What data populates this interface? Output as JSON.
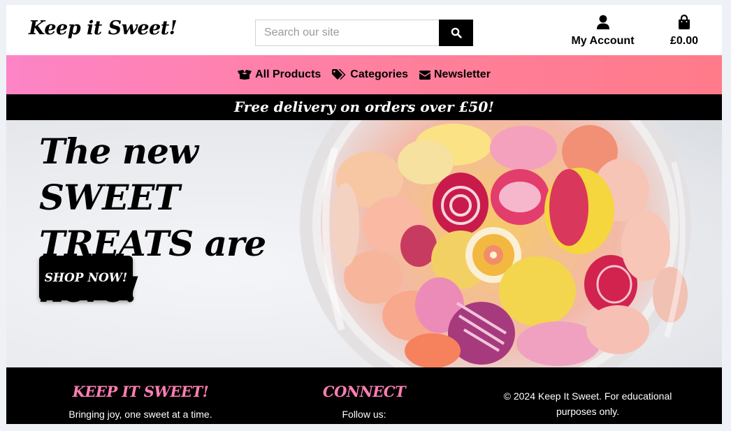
{
  "header": {
    "brand": "Keep it Sweet!",
    "search_placeholder": "Search our site",
    "account_label": "My Account",
    "bag_total": "£0.00"
  },
  "nav": {
    "items": [
      {
        "label": "All Products",
        "icon": "box-open-icon"
      },
      {
        "label": "Categories",
        "icon": "tags-icon"
      },
      {
        "label": "Newsletter",
        "icon": "envelope-icon"
      }
    ]
  },
  "banner": {
    "text": "Free delivery on orders over £50!"
  },
  "hero": {
    "heading": "The new SWEET TREATS are here!",
    "cta_label": "SHOP NOW!"
  },
  "footer": {
    "brand_heading": "Keep it Sweet!",
    "brand_tagline": "Bringing joy, one sweet at a time.",
    "connect_heading": "Connect",
    "connect_text": "Follow us:",
    "copyright": "© 2024 Keep It Sweet. For educational purposes only."
  },
  "colors": {
    "accent_pink": "#ff7eb3",
    "nav_gradient_start": "#fd84c6",
    "nav_gradient_end": "#ff7b8a",
    "dark": "#000000"
  }
}
